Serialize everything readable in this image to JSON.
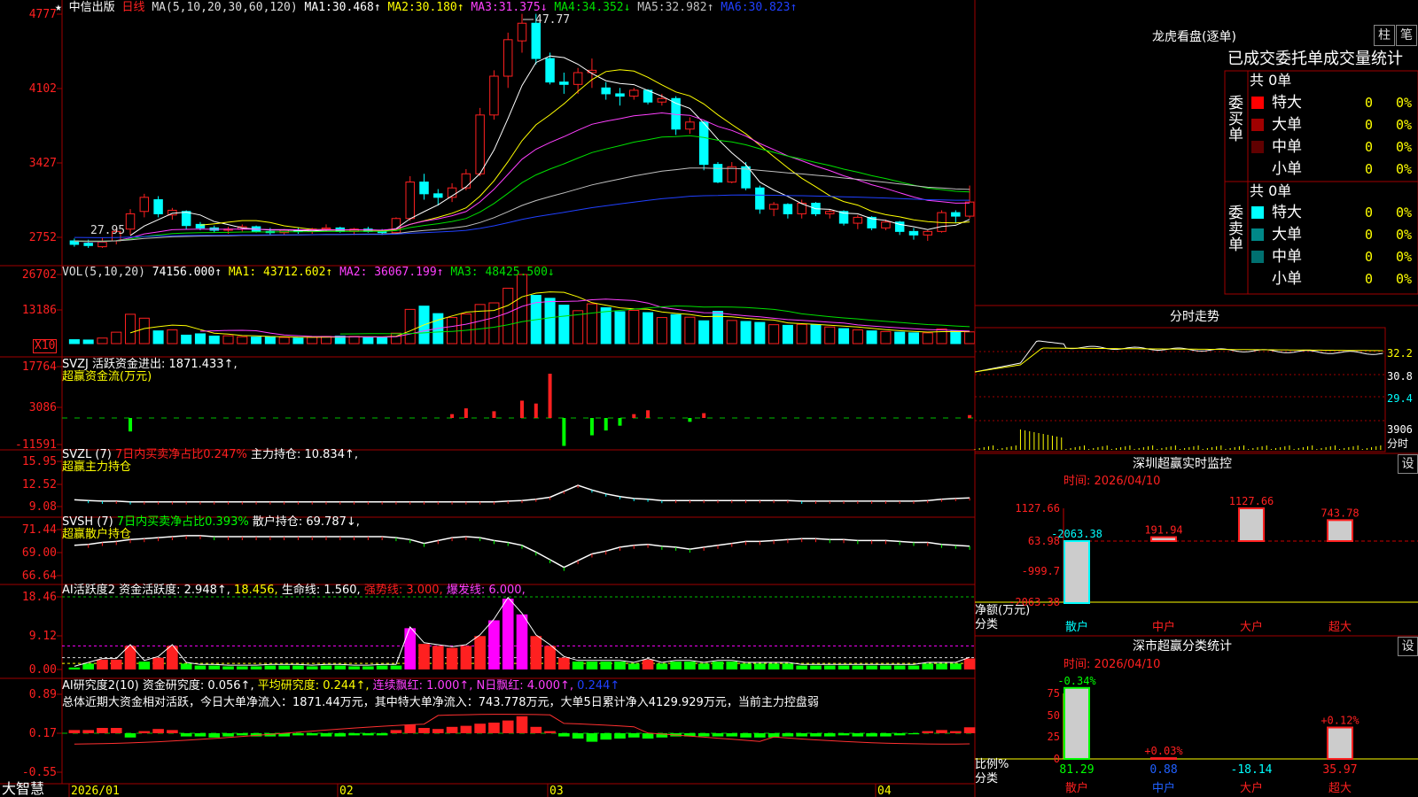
{
  "colors": {
    "up": "#ff2020",
    "down": "#00ffff",
    "ma1": "#ffffff",
    "ma2": "#ffff00",
    "ma3": "#ff40ff",
    "ma4": "#00e000",
    "ma5": "#c0c0c0",
    "ma6": "#2040ff",
    "grid": "#a00000",
    "green": "#00ff00",
    "magenta": "#ff00ff"
  },
  "kline": {
    "name": "中信出版",
    "period": "日线",
    "ma_params": "MA(5,10,20,30,60,120)",
    "ma_values": [
      {
        "k": "MA1:",
        "v": "30.468↑"
      },
      {
        "k": "MA2:",
        "v": "30.180↑"
      },
      {
        "k": "MA3:",
        "v": "31.375↓"
      },
      {
        "k": "MA4:",
        "v": "34.352↓"
      },
      {
        "k": "MA5:",
        "v": "32.982↑"
      },
      {
        "k": "MA6:",
        "v": "30.823↑"
      }
    ],
    "y_ticks": [
      "4777",
      "4102",
      "3427",
      "2752"
    ],
    "high_label": "47.77",
    "low_label": "27.95",
    "ylim": [
      2700,
      4800
    ]
  },
  "vol": {
    "header": "VOL(5,10,20)",
    "value": "74156.000↑",
    "ma1": "MA1: 43712.602↑",
    "ma2": "MA2: 36067.199↑",
    "ma3": "MA3: 48425.500↓",
    "y_ticks": [
      "26702",
      "13186"
    ],
    "unit": "X10"
  },
  "svzj": {
    "header": "SVZJ  活跃资金进出: 1871.433↑,",
    "sub": "超赢资金流(万元)",
    "y_ticks": [
      "17764",
      "3086",
      "-11591"
    ]
  },
  "svzl": {
    "header": "SVZL (7)",
    "ratio": "7日内买卖净占比0.247%",
    "hold": "主力持仓: 10.834↑,",
    "sub": "超赢主力持仓",
    "y_ticks": [
      "15.95",
      "12.52",
      "9.08"
    ]
  },
  "svsh": {
    "header": "SVSH (7)",
    "ratio": "7日内买卖净占比0.393%",
    "hold": "散户持仓: 69.787↓,",
    "sub": "超赢散户持仓",
    "y_ticks": [
      "71.44",
      "69.00",
      "66.64"
    ]
  },
  "ai1": {
    "header": "AI活跃度2",
    "a": "资金活跃度: 2.948↑,",
    "b": "18.456,",
    "c": "生命线: 1.560,",
    "d": "强势线: 3.000,",
    "e": "爆发线: 6.000,",
    "y_ticks": [
      "18.46",
      "9.12",
      "0.00"
    ]
  },
  "ai2": {
    "header": "AI研究度2(10)",
    "a": "资金研究度: 0.056↑,",
    "b": "平均研究度: 0.244↑,",
    "c": "连续飘红: 1.000↑,",
    "d": "N日飘红: 4.000↑,",
    "e": "0.244↑",
    "summary": "总体近期大资金相对活跃，今日大单净流入：1871.44万元，其中特大单净流入：743.778万元，大单5日累计净入4129.929万元，当前主力控盘弱",
    "y_ticks": [
      "0.89",
      "0.17",
      "-0.55"
    ]
  },
  "xaxis": {
    "brand": "大智慧",
    "labels": [
      "2026/01",
      "02",
      "03",
      "04"
    ]
  },
  "right": {
    "title": "龙虎看盘(逐单)",
    "btn1": "柱",
    "btn2": "笔",
    "stat_title": "已成交委托单成交量统计",
    "buy_label": "委买单",
    "sell_label": "委卖单",
    "buy_total": "共 0单",
    "sell_total": "共 0单",
    "buy_rows": [
      {
        "name": "特大",
        "v": "0",
        "p": "0%",
        "c": "#ff0000"
      },
      {
        "name": "大单",
        "v": "0",
        "p": "0%",
        "c": "#a00000"
      },
      {
        "name": "中单",
        "v": "0",
        "p": "0%",
        "c": "#600000"
      },
      {
        "name": "小单",
        "v": "0",
        "p": "0%",
        "c": "#000000"
      }
    ],
    "sell_rows": [
      {
        "name": "特大",
        "v": "0",
        "p": "0%",
        "c": "#00ffff"
      },
      {
        "name": "大单",
        "v": "0",
        "p": "0%",
        "c": "#008888"
      },
      {
        "name": "中单",
        "v": "0",
        "p": "0%",
        "c": "#007070"
      },
      {
        "name": "小单",
        "v": "0",
        "p": "0%",
        "c": "#000000"
      }
    ],
    "fs_title": "分时走势",
    "fs_ticks": [
      "32.2",
      "30.8",
      "29.4"
    ],
    "fs_vol": "3906",
    "fs_unit": "分时",
    "mon_title": "深圳超赢实时监控",
    "mon_date": "时间: 2026/04/10",
    "mon_ticks": [
      "1127.66",
      "63.98",
      "-999.7",
      "-2063.38"
    ],
    "mon_axis1": "净额(万元)",
    "mon_axis2": "分类",
    "mon_bars": [
      {
        "cat": "散户",
        "v": "-2063.38"
      },
      {
        "cat": "中户",
        "v": "191.94"
      },
      {
        "cat": "大户",
        "v": "1127.66"
      },
      {
        "cat": "超大",
        "v": "743.78"
      }
    ],
    "cls_title": "深市超赢分类统计",
    "cls_date": "时间: 2026/04/10",
    "cls_ticks": [
      "75",
      "50",
      "25",
      "0"
    ],
    "cls_axis1": "比例%",
    "cls_axis2": "分类",
    "cls_bars": [
      {
        "cat": "散户",
        "pct": "81.29",
        "chg": "-0.34%"
      },
      {
        "cat": "中户",
        "pct": "0.88",
        "chg": "+0.03%"
      },
      {
        "cat": "大户",
        "pct": "-18.14",
        "chg": ""
      },
      {
        "cat": "超大",
        "pct": "35.97",
        "chg": "+0.12%"
      }
    ],
    "set": "设"
  },
  "chart_data": [
    {
      "type": "candlestick",
      "title": "中信出版 日线",
      "ylim": [
        2700,
        4800
      ],
      "ohlc": [
        [
          2850,
          2870,
          2800,
          2820
        ],
        [
          2830,
          2860,
          2790,
          2810
        ],
        [
          2800,
          2880,
          2790,
          2840
        ],
        [
          2850,
          2960,
          2820,
          2930
        ],
        [
          2950,
          3120,
          2900,
          3080
        ],
        [
          3100,
          3250,
          3050,
          3220
        ],
        [
          3200,
          3230,
          3050,
          3080
        ],
        [
          3070,
          3130,
          3030,
          3110
        ],
        [
          3100,
          3110,
          2950,
          2980
        ],
        [
          2990,
          3010,
          2940,
          2960
        ],
        [
          2960,
          2980,
          2920,
          2940
        ],
        [
          2940,
          2970,
          2910,
          2950
        ],
        [
          2950,
          2990,
          2930,
          2970
        ],
        [
          2970,
          2980,
          2920,
          2930
        ],
        [
          2930,
          2960,
          2900,
          2920
        ],
        [
          2920,
          2950,
          2900,
          2940
        ],
        [
          2940,
          2960,
          2910,
          2930
        ],
        [
          2930,
          2960,
          2910,
          2950
        ],
        [
          2950,
          2990,
          2930,
          2960
        ],
        [
          2960,
          2970,
          2920,
          2930
        ],
        [
          2930,
          2960,
          2900,
          2950
        ],
        [
          2950,
          2970,
          2920,
          2930
        ],
        [
          2930,
          2950,
          2900,
          2920
        ],
        [
          2920,
          3050,
          2910,
          3040
        ],
        [
          3040,
          3400,
          3020,
          3350
        ],
        [
          3350,
          3420,
          3200,
          3250
        ],
        [
          3250,
          3290,
          3150,
          3220
        ],
        [
          3220,
          3340,
          3180,
          3300
        ],
        [
          3300,
          3460,
          3280,
          3420
        ],
        [
          3420,
          3980,
          3400,
          3920
        ],
        [
          3920,
          4300,
          3880,
          4250
        ],
        [
          4250,
          4620,
          4150,
          4560
        ],
        [
          4550,
          4780,
          4450,
          4700
        ],
        [
          4700,
          4780,
          4350,
          4400
        ],
        [
          4400,
          4450,
          4180,
          4200
        ],
        [
          4200,
          4280,
          4100,
          4180
        ],
        [
          4180,
          4320,
          4100,
          4280
        ],
        [
          4280,
          4400,
          4150,
          4300
        ],
        [
          4150,
          4200,
          4050,
          4100
        ],
        [
          4100,
          4150,
          4000,
          4080
        ],
        [
          4080,
          4150,
          4050,
          4130
        ],
        [
          4130,
          4140,
          4010,
          4030
        ],
        [
          4030,
          4100,
          4000,
          4060
        ],
        [
          4060,
          4080,
          3750,
          3800
        ],
        [
          3800,
          3900,
          3760,
          3860
        ],
        [
          3860,
          3870,
          3450,
          3500
        ],
        [
          3500,
          3520,
          3340,
          3350
        ],
        [
          3350,
          3520,
          3340,
          3480
        ],
        [
          3480,
          3520,
          3280,
          3300
        ],
        [
          3300,
          3320,
          3080,
          3120
        ],
        [
          3120,
          3180,
          3060,
          3160
        ],
        [
          3160,
          3170,
          3040,
          3080
        ],
        [
          3080,
          3200,
          3040,
          3170
        ],
        [
          3170,
          3180,
          3060,
          3080
        ],
        [
          3080,
          3120,
          3040,
          3100
        ],
        [
          3100,
          3110,
          2980,
          3000
        ],
        [
          3000,
          3070,
          2950,
          3050
        ],
        [
          3050,
          3060,
          2940,
          2960
        ],
        [
          2960,
          3030,
          2940,
          3010
        ],
        [
          3010,
          3020,
          2900,
          2930
        ],
        [
          2930,
          2960,
          2860,
          2900
        ],
        [
          2900,
          2940,
          2850,
          2930
        ],
        [
          2930,
          3110,
          2920,
          3090
        ],
        [
          3090,
          3110,
          3000,
          3060
        ],
        [
          3060,
          3320,
          3040,
          3180
        ]
      ]
    },
    {
      "type": "bar",
      "title": "VOL",
      "values": [
        1200,
        1100,
        1700,
        3500,
        9000,
        7800,
        3900,
        4200,
        2600,
        3000,
        2300,
        2400,
        2100,
        2000,
        2100,
        1900,
        1700,
        2000,
        2200,
        2300,
        2200,
        1800,
        1800,
        3200,
        10500,
        11500,
        9200,
        8000,
        9100,
        12000,
        12500,
        17000,
        21200,
        14800,
        13900,
        11800,
        10100,
        12200,
        11000,
        9800,
        10200,
        9500,
        8000,
        8900,
        8100,
        7000,
        9900,
        7100,
        6800,
        6500,
        5800,
        5600,
        5900,
        5700,
        5100,
        4600,
        4200,
        3900,
        3700,
        3500,
        3300,
        3300,
        4500,
        3800,
        3600
      ]
    },
    {
      "type": "bar",
      "title": "超赢资金流(万元)",
      "values": [
        0,
        0,
        0,
        0,
        -1400,
        0,
        0,
        0,
        0,
        0,
        0,
        0,
        0,
        0,
        0,
        0,
        0,
        0,
        0,
        0,
        0,
        0,
        0,
        0,
        0,
        0,
        0,
        400,
        1000,
        0,
        700,
        0,
        1800,
        1500,
        4600,
        -2900,
        0,
        -1800,
        -1300,
        -800,
        400,
        800,
        0,
        0,
        -400,
        500,
        0,
        0,
        0,
        0,
        0,
        0,
        0,
        0,
        0,
        0,
        0,
        0,
        0,
        0,
        0,
        0,
        0,
        0,
        300
      ]
    },
    {
      "type": "line",
      "title": "超赢主力持仓",
      "values": [
        10.1,
        10.0,
        9.9,
        9.9,
        9.8,
        9.8,
        9.8,
        9.8,
        9.8,
        9.8,
        9.8,
        9.8,
        9.8,
        9.8,
        9.8,
        9.8,
        9.8,
        9.8,
        9.8,
        9.8,
        9.8,
        9.8,
        9.8,
        9.8,
        9.8,
        9.8,
        9.8,
        9.8,
        9.8,
        9.8,
        9.8,
        9.9,
        10.0,
        10.2,
        10.5,
        11.4,
        12.3,
        11.6,
        11.0,
        10.6,
        10.3,
        10.2,
        10.0,
        10.0,
        10.0,
        10.0,
        10.0,
        10.0,
        10.0,
        10.0,
        10.0,
        10.0,
        9.9,
        9.9,
        9.9,
        9.9,
        9.9,
        9.9,
        9.9,
        9.9,
        9.9,
        10.0,
        10.2,
        10.3,
        10.4
      ]
    },
    {
      "type": "line",
      "title": "超赢散户持仓",
      "values": [
        69.8,
        69.9,
        70.1,
        70.2,
        70.4,
        70.5,
        70.6,
        70.7,
        70.8,
        70.8,
        70.7,
        70.7,
        70.7,
        70.7,
        70.7,
        70.7,
        70.7,
        70.7,
        70.7,
        70.7,
        70.7,
        70.7,
        70.7,
        70.6,
        70.4,
        70.0,
        70.3,
        70.6,
        70.7,
        70.6,
        70.3,
        70.1,
        69.8,
        69.1,
        68.3,
        67.5,
        68.2,
        68.9,
        69.2,
        69.6,
        69.8,
        69.9,
        69.7,
        69.6,
        69.4,
        69.6,
        69.8,
        70.0,
        70.2,
        70.2,
        70.3,
        70.4,
        70.5,
        70.5,
        70.4,
        70.4,
        70.3,
        70.3,
        70.3,
        70.2,
        70.1,
        70.1,
        69.9,
        69.8,
        69.7
      ]
    },
    {
      "type": "bar",
      "title": "AI活跃度2",
      "values": [
        0.5,
        1.5,
        2.5,
        2.5,
        6.0,
        2.0,
        3.0,
        6.0,
        1.5,
        1.0,
        1.0,
        0.8,
        0.8,
        0.8,
        1.0,
        1.0,
        1.0,
        0.8,
        1.0,
        1.0,
        0.8,
        0.8,
        1.0,
        1.0,
        10.5,
        6.5,
        6.0,
        5.5,
        6.0,
        8.5,
        12.5,
        18.0,
        14.0,
        8.5,
        6.0,
        3.0,
        2.0,
        2.0,
        2.0,
        2.0,
        1.5,
        2.5,
        1.5,
        2.0,
        2.0,
        1.5,
        2.0,
        2.0,
        1.5,
        1.5,
        1.5,
        1.5,
        1.0,
        1.0,
        1.0,
        1.0,
        1.0,
        1.0,
        1.0,
        1.0,
        1.0,
        1.5,
        1.5,
        1.5,
        2.8
      ]
    },
    {
      "type": "bar",
      "title": "AI研究度2(10)",
      "values": [
        0.03,
        0.03,
        0.05,
        0.05,
        -0.04,
        0.02,
        0.04,
        0.03,
        -0.03,
        -0.03,
        -0.04,
        -0.03,
        -0.02,
        -0.03,
        -0.03,
        -0.03,
        -0.02,
        -0.02,
        -0.03,
        -0.03,
        -0.02,
        -0.02,
        -0.02,
        0.03,
        0.08,
        0.05,
        0.04,
        0.06,
        0.07,
        0.09,
        0.1,
        0.12,
        0.16,
        0.06,
        0.02,
        -0.03,
        -0.05,
        -0.08,
        -0.06,
        -0.05,
        -0.04,
        -0.05,
        -0.04,
        -0.03,
        -0.03,
        -0.03,
        -0.03,
        -0.03,
        -0.04,
        -0.04,
        -0.04,
        -0.03,
        -0.03,
        -0.03,
        -0.03,
        -0.02,
        -0.03,
        -0.03,
        -0.03,
        -0.02,
        -0.01,
        0.02,
        0.03,
        0.02,
        0.056
      ]
    },
    {
      "type": "line",
      "title": "分时走势"
    },
    {
      "type": "bar",
      "title": "深圳超赢实时监控",
      "categories": [
        "散户",
        "中户",
        "大户",
        "超大"
      ],
      "values": [
        -2063.38,
        191.94,
        1127.66,
        743.78
      ]
    },
    {
      "type": "bar",
      "title": "深市超赢分类统计",
      "categories": [
        "散户",
        "中户",
        "大户",
        "超大"
      ],
      "values": [
        81.29,
        0.88,
        -18.14,
        35.97
      ]
    }
  ]
}
